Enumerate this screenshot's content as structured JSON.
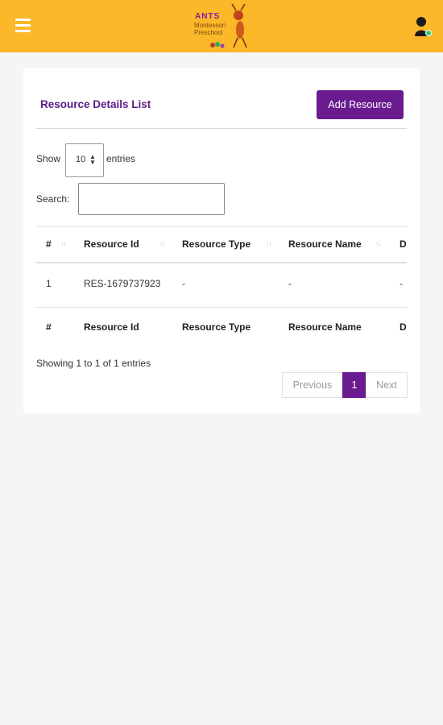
{
  "header": {
    "menu_icon": "hamburger-icon",
    "logo": {
      "line1": "ANTS",
      "line2": "Montessori",
      "line3": "Preschool"
    },
    "user_icon": "user-avatar-icon",
    "status_color": "#2ecc71",
    "bar_color": "#fbb829"
  },
  "card": {
    "title": "Resource Details List",
    "add_button": "Add Resource",
    "accent_color": "#6a1b8f",
    "show_label": "Show",
    "page_length": "10",
    "entries_label": "entries",
    "search_label": "Search:",
    "search_value": "",
    "columns": [
      "#",
      "Resource Id",
      "Resource Type",
      "Resource Name",
      "D"
    ],
    "rows": [
      [
        "1",
        "RES-1679737923",
        "-",
        "-",
        "-"
      ]
    ],
    "info": "Showing 1 to 1 of 1 entries",
    "pagination": {
      "previous": "Previous",
      "current": "1",
      "next": "Next"
    }
  }
}
